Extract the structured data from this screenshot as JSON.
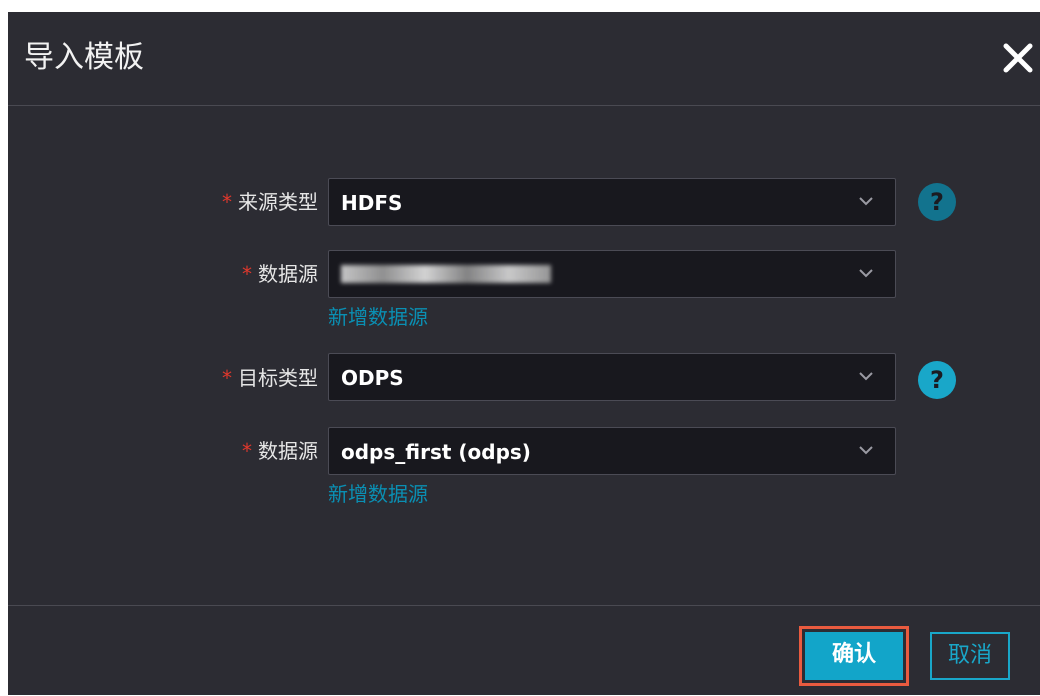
{
  "dialog": {
    "title": "导入模板",
    "close_icon": "close-icon"
  },
  "form": {
    "required_mark": "*",
    "source_type": {
      "label": "来源类型",
      "value": "HDFS",
      "help_icon": "question-icon"
    },
    "source_datasource": {
      "label": "数据源",
      "value": "",
      "value_obscured": true,
      "add_link": "新增数据源"
    },
    "target_type": {
      "label": "目标类型",
      "value": "ODPS",
      "help_icon": "question-icon"
    },
    "target_datasource": {
      "label": "数据源",
      "value": "odps_first (odps)",
      "add_link": "新增数据源"
    }
  },
  "footer": {
    "confirm_label": "确认",
    "cancel_label": "取消"
  },
  "colors": {
    "dialog_bg": "#2c2c33",
    "field_bg": "#18181e",
    "accent": "#12a5c9",
    "link": "#0a8fb3",
    "required": "#e0382c",
    "highlight": "#e95b3f"
  }
}
